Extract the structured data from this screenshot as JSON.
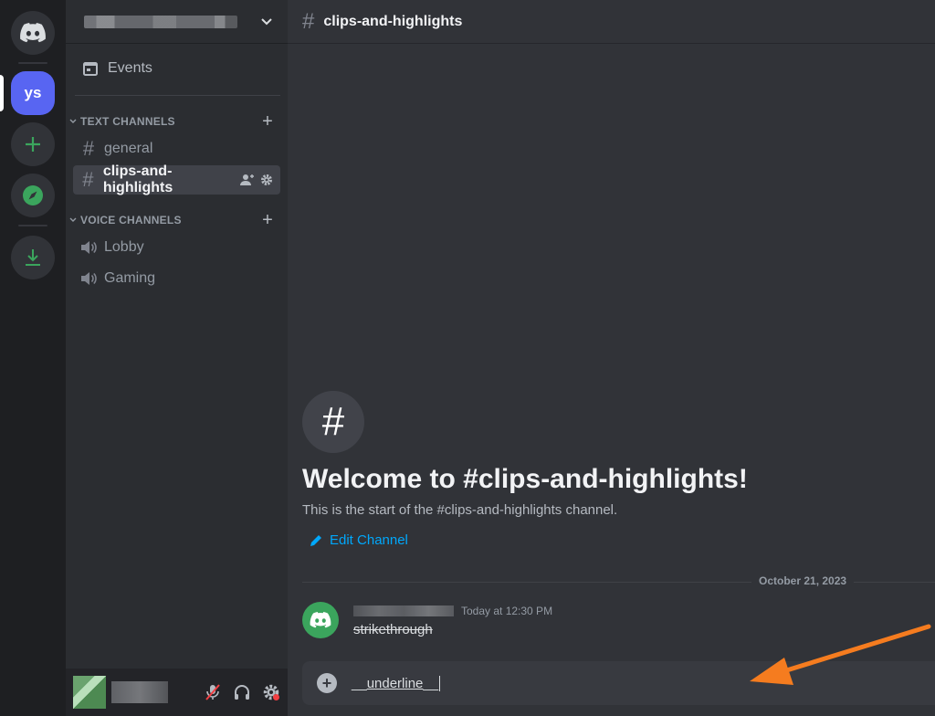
{
  "rail": {
    "home_icon": "discord-logo-icon",
    "servers": [
      {
        "label": "ys",
        "active": true
      }
    ],
    "add_server_icon": "plus-icon",
    "explore_icon": "compass-icon",
    "download_icon": "download-icon"
  },
  "sidebar": {
    "server_name": "[blurred]",
    "events_label": "Events",
    "text_category": "TEXT CHANNELS",
    "text_channels": [
      {
        "name": "general",
        "selected": false
      },
      {
        "name": "clips-and-highlights",
        "selected": true
      }
    ],
    "voice_category": "VOICE CHANNELS",
    "voice_channels": [
      {
        "name": "Lobby"
      },
      {
        "name": "Gaming"
      }
    ]
  },
  "main": {
    "channel_title": "clips-and-highlights",
    "welcome_icon": "#",
    "welcome_title": "Welcome to #clips-and-highlights!",
    "welcome_subtitle": "This is the start of the #clips-and-highlights channel.",
    "edit_channel_label": "Edit Channel",
    "date_divider": "October 21, 2023",
    "message": {
      "timestamp": "Today at 12:30 PM",
      "text": "strikethrough"
    },
    "composer": {
      "prefix": "__",
      "value": "underline",
      "suffix": "__"
    }
  },
  "colors": {
    "accent": "#5865f2",
    "link": "#00a8fc",
    "green": "#3ba55d",
    "annotation_arrow": "#f57c1f",
    "mute_slash": "#f23f43"
  }
}
